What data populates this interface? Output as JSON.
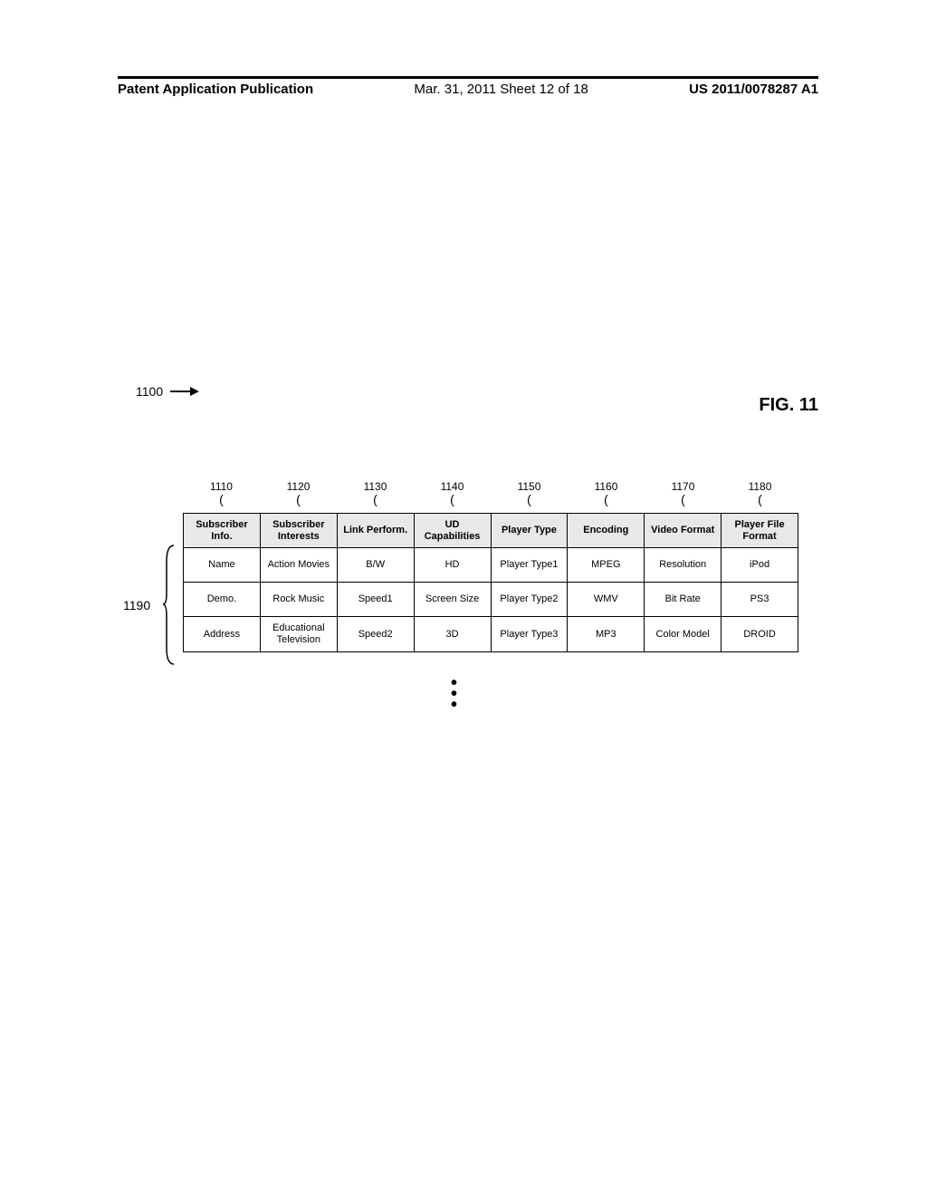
{
  "header": {
    "left": "Patent Application Publication",
    "mid": "Mar. 31, 2011  Sheet 12 of 18",
    "right": "US 2011/0078287 A1"
  },
  "figure": {
    "ref": "1100",
    "title": "FIG. 11",
    "row_group_ref": "1190"
  },
  "columns": [
    {
      "ref": "1110",
      "header": "Subscriber Info."
    },
    {
      "ref": "1120",
      "header": "Subscriber Interests"
    },
    {
      "ref": "1130",
      "header": "Link Perform."
    },
    {
      "ref": "1140",
      "header": "UD Capabilities"
    },
    {
      "ref": "1150",
      "header": "Player Type"
    },
    {
      "ref": "1160",
      "header": "Encoding"
    },
    {
      "ref": "1170",
      "header": "Video Format"
    },
    {
      "ref": "1180",
      "header": "Player File Format"
    }
  ],
  "rows": [
    [
      "Name",
      "Action Movies",
      "B/W",
      "HD",
      "Player Type1",
      "MPEG",
      "Resolution",
      "iPod"
    ],
    [
      "Demo.",
      "Rock Music",
      "Speed1",
      "Screen Size",
      "Player Type2",
      "WMV",
      "Bit Rate",
      "PS3"
    ],
    [
      "Address",
      "Educational Television",
      "Speed2",
      "3D",
      "Player Type3",
      "MP3",
      "Color Model",
      "DROID"
    ]
  ]
}
